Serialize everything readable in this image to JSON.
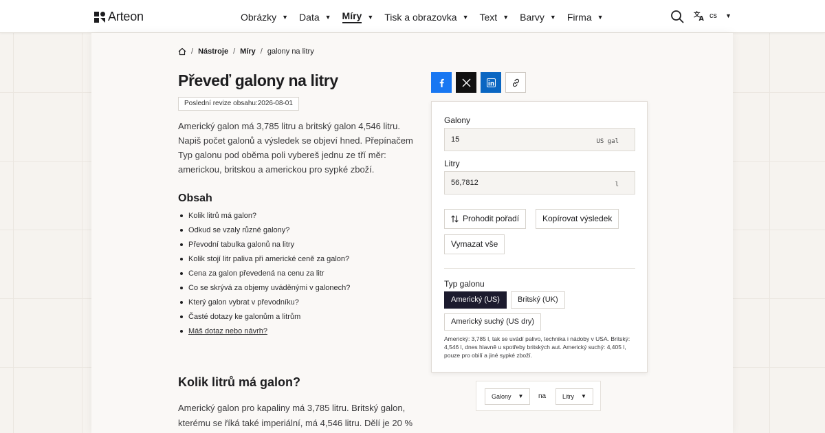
{
  "header": {
    "logo_text": "Arteon",
    "nav": [
      {
        "label": "Obrázky"
      },
      {
        "label": "Data"
      },
      {
        "label": "Míry"
      },
      {
        "label": "Tisk a obrazovka"
      },
      {
        "label": "Text"
      },
      {
        "label": "Barvy"
      },
      {
        "label": "Firma"
      }
    ],
    "lang": "cs"
  },
  "breadcrumb": {
    "items": [
      "Nástroje",
      "Míry",
      "galony na litry"
    ]
  },
  "page": {
    "title": "Převeď galony na litry",
    "revision_label": "Poslední revize obsahu:",
    "revision_date": "2026-08-01",
    "intro": "Americký galon má 3,785 litru a britský galon 4,546 litru. Napiš počet galonů a výsledek se objeví hned. Přepínačem Typ galonu pod oběma poli vybereš jednu ze tří měr: americkou, britskou a americkou pro sypké zboží.",
    "toc_heading": "Obsah",
    "toc": [
      "Kolik litrů má galon?",
      "Odkud se vzaly různé galony?",
      "Převodní tabulka galonů na litry",
      "Kolik stojí litr paliva při americké ceně za galon?",
      "Cena za galon převedená na cenu za litr",
      "Co se skrývá za objemy uváděnými v galonech?",
      "Který galon vybrat v převodníku?",
      "Časté dotazy ke galonům a litrům",
      "Máš dotaz nebo návrh?"
    ],
    "section_heading": "Kolik litrů má galon?",
    "section_body": "Americký galon pro kapaliny má 3,785 litru. Britský galon, kterému se říká také imperiální, má 4,546 litru. Dělí je 20 %"
  },
  "converter": {
    "from_label": "Galony",
    "from_value": "15",
    "from_unit": "US gal",
    "to_label": "Litry",
    "to_value": "56,7812",
    "to_unit": "l",
    "swap_label": "Prohodit pořadí",
    "copy_label": "Kopírovat výsledek",
    "clear_label": "Vymazat vše",
    "type_label": "Typ galonu",
    "types": [
      {
        "label": "Americký (US)",
        "active": true
      },
      {
        "label": "Britský (UK)",
        "active": false
      },
      {
        "label": "Americký suchý (US dry)",
        "active": false
      }
    ],
    "note": "Americký: 3,785 l, tak se uvádí palivo, technika i nádoby v USA. Britský: 4,546 l, dnes hlavně u spotřeby britských aut. Americký suchý: 4,405 l, pouze pro obilí a jiné sypké zboží."
  },
  "pair": {
    "from": "Galony",
    "connector": "na",
    "to": "Litry"
  },
  "colors": {
    "active_segment": "#1c1b2e",
    "facebook": "#1877f2",
    "x": "#111111",
    "linkedin": "#0a66c2"
  }
}
